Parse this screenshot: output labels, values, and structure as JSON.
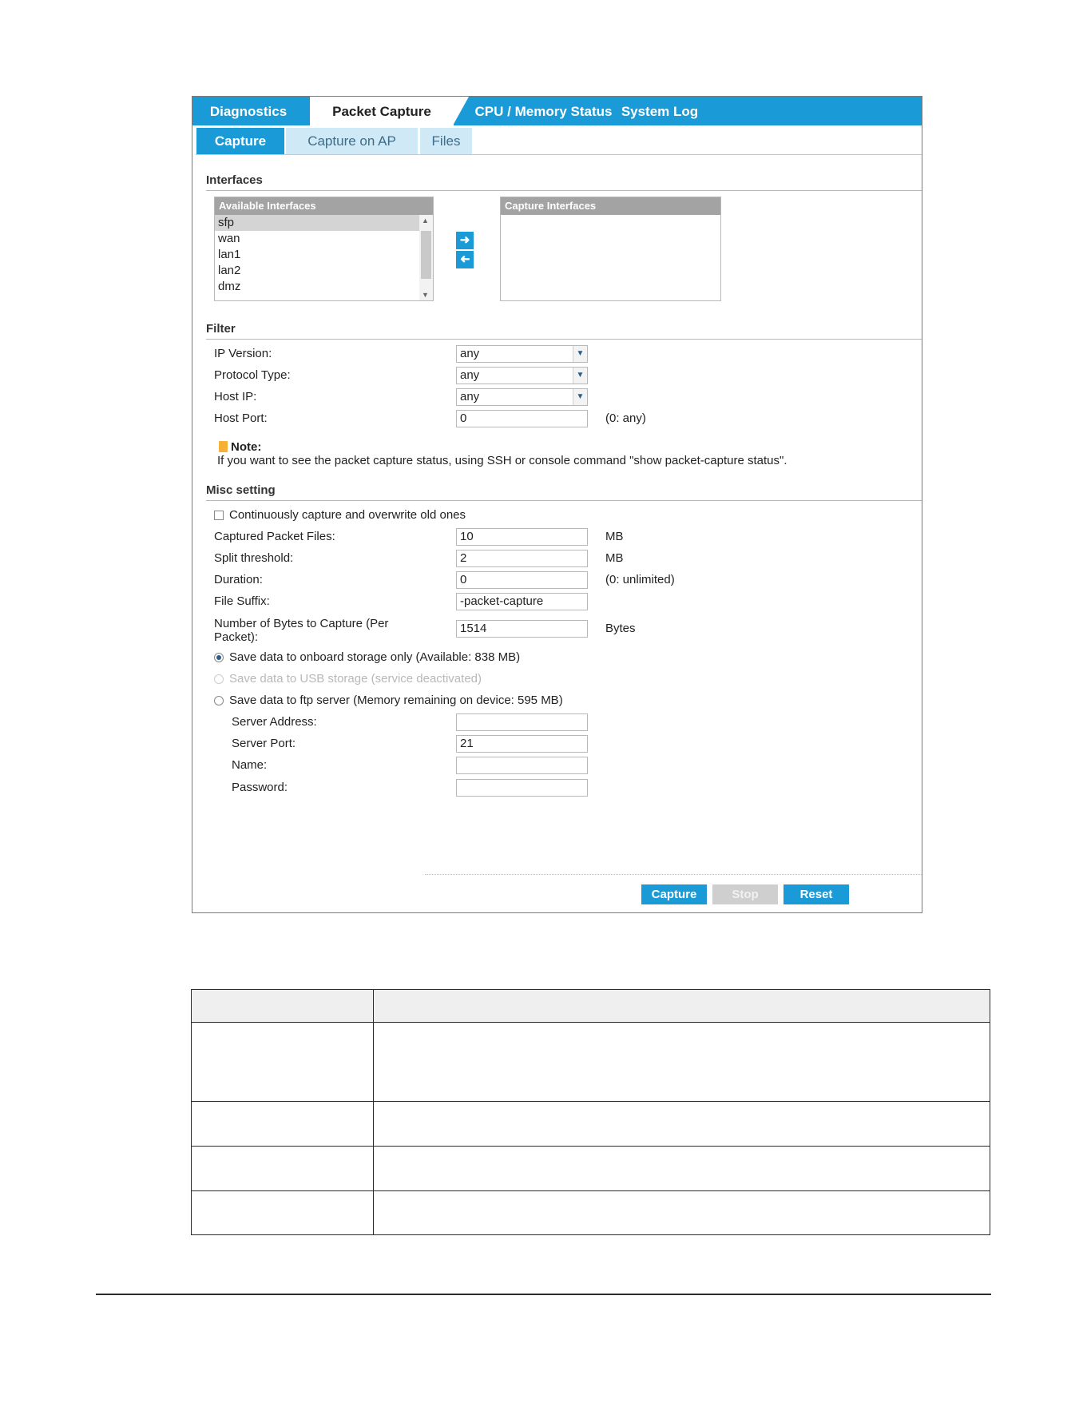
{
  "main_tabs": [
    "Diagnostics",
    "Packet Capture",
    "CPU / Memory Status",
    "System Log"
  ],
  "sub_tabs": [
    "Capture",
    "Capture on AP",
    "Files"
  ],
  "interfaces": {
    "title": "Interfaces",
    "available_header": "Available Interfaces",
    "available": [
      "sfp",
      "wan",
      "lan1",
      "lan2",
      "dmz"
    ],
    "capture_header": "Capture Interfaces",
    "add_icon": "arrow-right-icon",
    "remove_icon": "arrow-left-icon"
  },
  "filter": {
    "title": "Filter",
    "ip_version_label": "IP Version:",
    "ip_version_value": "any",
    "protocol_label": "Protocol Type:",
    "protocol_value": "any",
    "host_ip_label": "Host IP:",
    "host_ip_value": "any",
    "host_port_label": "Host Port:",
    "host_port_value": "0",
    "host_port_hint": "(0: any)"
  },
  "note": {
    "title": "Note:",
    "text": "If you want to see the packet capture status, using SSH or console command \"show packet-capture status\"."
  },
  "misc": {
    "title": "Misc setting",
    "continuous_label": "Continuously capture and overwrite old ones",
    "continuous_checked": false,
    "captured_files_label": "Captured Packet Files:",
    "captured_files_value": "10",
    "captured_files_unit": "MB",
    "split_label": "Split threshold:",
    "split_value": "2",
    "split_unit": "MB",
    "duration_label": "Duration:",
    "duration_value": "0",
    "duration_hint": "(0: unlimited)",
    "suffix_label": "File Suffix:",
    "suffix_value": "-packet-capture",
    "bytes_label_line1": "Number of Bytes to Capture (Per",
    "bytes_label_line2": "Packet):",
    "bytes_value": "1514",
    "bytes_unit": "Bytes",
    "onboard_label": "Save data to onboard storage only (Available: 838 MB)",
    "usb_label": "Save data to USB storage (service deactivated)",
    "ftp_label": "Save data to ftp server (Memory remaining on device: 595 MB)",
    "server_address_label": "Server Address:",
    "server_address_value": "",
    "server_port_label": "Server Port:",
    "server_port_value": "21",
    "name_label": "Name:",
    "name_value": "",
    "password_label": "Password:",
    "password_value": ""
  },
  "buttons": {
    "capture": "Capture",
    "stop": "Stop",
    "reset": "Reset"
  }
}
